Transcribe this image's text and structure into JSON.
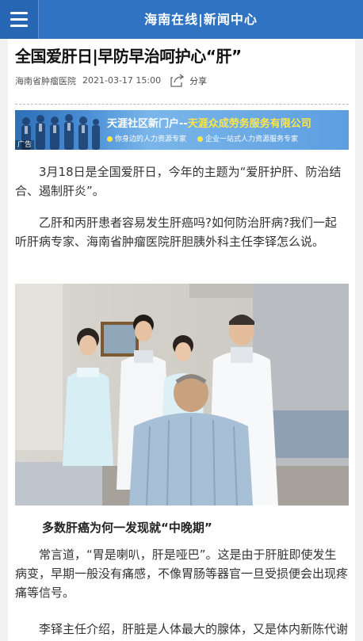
{
  "header": {
    "menu_icon": "hamburger-menu-icon",
    "site_title": "海南在线|新闻中心"
  },
  "article": {
    "title": "全国爱肝日|早防早治呵护心“肝”",
    "source": "海南省肿瘤医院",
    "date": "2021-03-17 15:00",
    "share_label": "分享",
    "share_icon": "share-icon"
  },
  "ad": {
    "title_white": "天涯社区新门户--",
    "title_yellow": "天涯众成劳务服务有限公司",
    "slogan_left": "你身边的人力资源专家",
    "slogan_right": "企业一站式人力资源服务专家",
    "tag": "广告"
  },
  "paragraphs": {
    "p1": "3月18日是全国爱肝日，今年的主题为“爱肝护肝、防治结合、遏制肝炎”。",
    "p2": "乙肝和丙肝患者容易发生肝癌吗?如何防治肝病?我们一起听肝病专家、海南省肿瘤医院肝胆胰外科主任李铎怎么说。",
    "subheading": "多数肝癌为何一发现就“中晚期”",
    "p3": "常言道，“胃是喇叭，肝是哑巴”。这是由于肝脏即使发生病变，早期一般没有痛感，不像胃肠等器官一旦受损便会出现疼痛等信号。",
    "p4": "李铎主任介绍，肝脏是人体最大的腺体，又是体内新陈代谢的中心站"
  },
  "colors": {
    "header_bg": "#2f73c2",
    "ad_yellow": "#ffe74a"
  }
}
